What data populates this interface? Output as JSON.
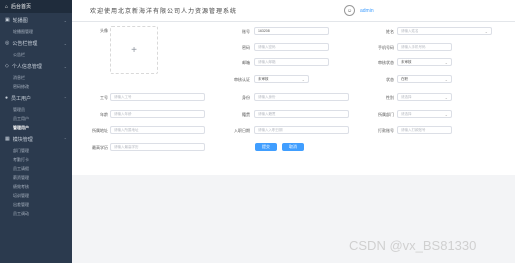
{
  "sidebar": {
    "brand": "后台首页",
    "groups": [
      {
        "label": "轮播图",
        "items": [
          "轮播图管理"
        ]
      },
      {
        "label": "公告栏管理",
        "items": [
          "公告栏"
        ]
      },
      {
        "label": "个人信息管理",
        "items": [
          "消息栏",
          "密码修改"
        ]
      },
      {
        "label": "员工用户",
        "items": [
          "管理员",
          "员工用户",
          "管理用户"
        ]
      },
      {
        "label": "模块管理",
        "items": [
          "部门管理",
          "考勤打卡",
          "员工请假",
          "薪资管理",
          "绩效考核",
          "培训管理",
          "出差管理",
          "员工调动"
        ]
      }
    ],
    "active_item": "管理用户"
  },
  "header": {
    "welcome": "欢迎使用北京新海洋有限公司人力资源管理系统",
    "username": "admin"
  },
  "form": {
    "avatar_label": "头像",
    "upload_plus": "+",
    "fields": {
      "account": {
        "label": "账号",
        "value": "163208"
      },
      "name": {
        "label": "姓名",
        "placeholder": "请输入姓名"
      },
      "password": {
        "label": "密码",
        "placeholder": "请输入密码"
      },
      "phone": {
        "label": "手机号码",
        "placeholder": "请输入手机号码"
      },
      "email": {
        "label": "邮箱",
        "placeholder": "请输入邮箱"
      },
      "audit": {
        "label": "审核状态",
        "value": "未审核"
      },
      "review": {
        "label": "审核认证",
        "value": "未审核"
      },
      "status": {
        "label": "状态",
        "value": "在职"
      },
      "job": {
        "label": "工号",
        "placeholder": "请输入工号"
      },
      "id_card": {
        "label": "身份",
        "placeholder": "请输入身份"
      },
      "gender": {
        "label": "性别",
        "placeholder": "请选择"
      },
      "age": {
        "label": "年龄",
        "placeholder": "请输入年龄"
      },
      "native": {
        "label": "籍贯",
        "placeholder": "请输入籍贯"
      },
      "dept": {
        "label": "所属部门",
        "placeholder": "请选择"
      },
      "address": {
        "label": "所属地址",
        "placeholder": "请输入所属地址"
      },
      "entry_date": {
        "label": "入职日期",
        "placeholder": "请输入入职日期"
      },
      "bank_account": {
        "label": "打款账号",
        "placeholder": "请输入打款账号"
      },
      "degree": {
        "label": "最高学历",
        "placeholder": "请输入最高学历"
      }
    },
    "submit_label": "提交",
    "cancel_label": "取消"
  },
  "watermark": "CSDN @vx_BS81330"
}
